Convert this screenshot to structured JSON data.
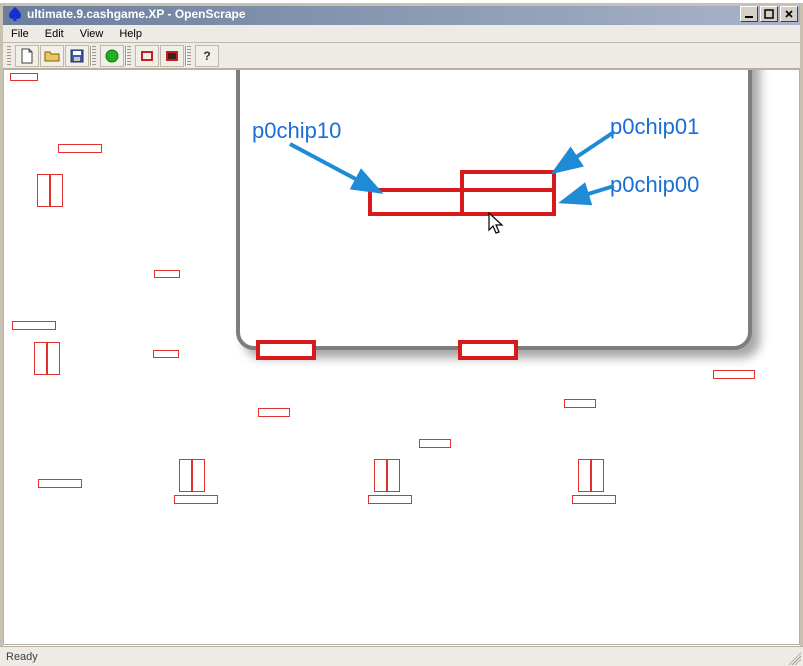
{
  "window": {
    "title": "ultimate.9.cashgame.XP - OpenScrape"
  },
  "menu": {
    "file": "File",
    "edit": "Edit",
    "view": "View",
    "help": "Help"
  },
  "labels": {
    "p0chip10": "p0chip10",
    "p0chip01": "p0chip01",
    "p0chip00": "p0chip00"
  },
  "status": {
    "text": "Ready"
  },
  "colors": {
    "red_outline": "#e03030",
    "red_thick": "#d91a1a",
    "label_blue": "#1a6ed8",
    "arrow_blue": "#1f8ad6",
    "callout_border": "#7e7e7e"
  },
  "icons": {
    "app": "spade-icon",
    "new": "new-file-icon",
    "open": "open-folder-icon",
    "save": "save-icon",
    "green": "green-circle-icon",
    "rect1": "rect-tool-icon",
    "rect2": "rect-tool-filled-icon",
    "help": "help-icon",
    "min": "minimize-icon",
    "max": "maximize-icon",
    "close": "close-icon"
  }
}
